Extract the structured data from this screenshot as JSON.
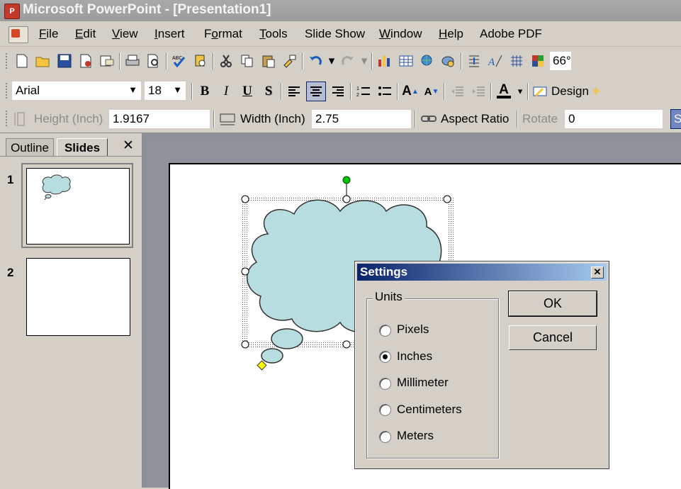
{
  "window": {
    "title": "Microsoft PowerPoint - [Presentation1]",
    "app_icon": "powerpoint-app-icon"
  },
  "menu": [
    {
      "label": "File",
      "key": "F"
    },
    {
      "label": "Edit",
      "key": "E"
    },
    {
      "label": "View",
      "key": "V"
    },
    {
      "label": "Insert",
      "key": "I"
    },
    {
      "label": "Format",
      "key": "o"
    },
    {
      "label": "Tools",
      "key": "T"
    },
    {
      "label": "Slide Show",
      "key": "D"
    },
    {
      "label": "Window",
      "key": "W"
    },
    {
      "label": "Help",
      "key": "H"
    },
    {
      "label": "Adobe PDF",
      "key": ""
    }
  ],
  "standard_toolbar": {
    "zoom": "66°"
  },
  "format_toolbar": {
    "font": "Arial",
    "size": "18",
    "design_label": "Design"
  },
  "size_toolbar": {
    "height_label": "Height (Inch)",
    "height_value": "1.9167",
    "width_label": "Width (Inch)",
    "width_value": "2.75",
    "aspect_label": "Aspect Ratio",
    "rotate_label": "Rotate",
    "rotate_value": "0",
    "s_button": "S"
  },
  "left_pane": {
    "tabs": [
      "Outline",
      "Slides"
    ],
    "close": "✕",
    "slides": [
      {
        "number": "1"
      },
      {
        "number": "2"
      }
    ]
  },
  "dialog": {
    "title": "Settings",
    "close": "✕",
    "group_label": "Units",
    "options": [
      {
        "label": "Pixels",
        "checked": false
      },
      {
        "label": "Inches",
        "checked": true
      },
      {
        "label": "Millimeter",
        "checked": false
      },
      {
        "label": "Centimeters",
        "checked": false
      },
      {
        "label": "Meters",
        "checked": false
      }
    ],
    "ok": "OK",
    "cancel": "Cancel"
  },
  "colors": {
    "cloud_fill": "#b8dde0",
    "selection_handle": "#ffffff",
    "rotate_handle": "#00c000",
    "adjust_handle": "#ffff00"
  }
}
